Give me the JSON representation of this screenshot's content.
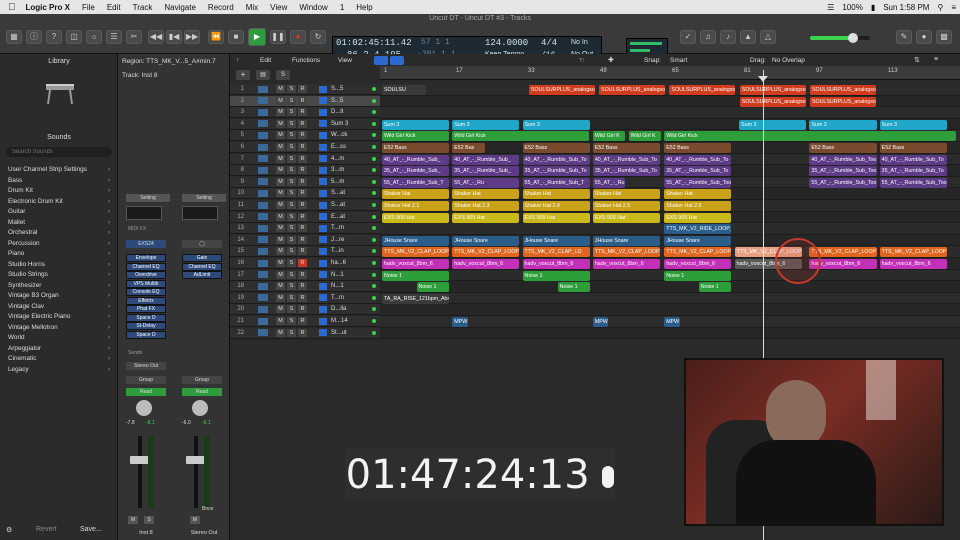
{
  "menubar": {
    "apple": "",
    "app": "Logic Pro X",
    "items": [
      "File",
      "Edit",
      "Track",
      "Navigate",
      "Record",
      "Mix",
      "View",
      "Window",
      "1",
      "Help"
    ],
    "right": [
      "100%",
      "Sun 1:58 PM"
    ]
  },
  "window_title": "Uncut DT - Uncut DT #3 - Tracks",
  "lcd": {
    "smpte": "01:02:45:11.42",
    "bars": "86  2  4  195",
    "ghost1": "57  1  1",
    "ghost2": "-201  1  1",
    "tempo": "124.0000",
    "tempo_mode": "Keep Tempo",
    "sig": "4/4",
    "div": "/16",
    "in": "No In",
    "out": "No Out"
  },
  "library": {
    "title": "Library",
    "sounds": "Sounds",
    "search_placeholder": "Search Sounds",
    "items": [
      "User Channel Strip Settings",
      "Bass",
      "Drum Kit",
      "Electronic Drum Kit",
      "Guitar",
      "Mallet",
      "Orchestral",
      "Percussion",
      "Piano",
      "Studio Horns",
      "Studio Strings",
      "Synthesizer",
      "Vintage B3 Organ",
      "Vintage Clav",
      "Vintage Electric Piano",
      "Vintage Mellotron",
      "World",
      "Arpeggiator",
      "Cinematic",
      "Legacy"
    ],
    "revert": "Revert",
    "save": "Save..."
  },
  "inspector": {
    "region": "Region: TTS_MK_V...5_A#min.7",
    "track": "Track: Inst 8",
    "setting": "Setting",
    "midifx": "MIDI FX",
    "exs": "EXS24",
    "plugins_left": [
      "Envelope",
      "Channel EQ",
      "Overdrive",
      "VPS Multib",
      "Console EQ",
      "Effetrix",
      "Phat FX",
      "Space D",
      "St-Delay",
      "Space D"
    ],
    "plugins_right": [
      "Gain",
      "Channel EQ",
      "AdLimit"
    ],
    "sends": "Sends",
    "stereo_out": "Stereo Out",
    "group": "Group",
    "read": "Read",
    "vol_left": "-7.8",
    "pk_left": "-8.1",
    "vol_right": "-6.0",
    "pk_right": "-6.1",
    "bnce": "Bnce",
    "name_left": "Inst 8",
    "name_right": "Stereo Out"
  },
  "track_header": {
    "edit": "Edit",
    "functions": "Functions",
    "view": "View"
  },
  "snap": {
    "label": "Snap:",
    "value": "Smart",
    "drag_label": "Drag:",
    "drag_value": "No Overlap"
  },
  "ruler": [
    "1",
    "17",
    "33",
    "49",
    "65",
    "81",
    "97",
    "113"
  ],
  "tracks": [
    {
      "n": "1",
      "name": "S...5"
    },
    {
      "n": "2",
      "name": "S...5"
    },
    {
      "n": "3",
      "name": "D...lt"
    },
    {
      "n": "4",
      "name": "Sum 3"
    },
    {
      "n": "5",
      "name": "W...ck"
    },
    {
      "n": "6",
      "name": "E...ss"
    },
    {
      "n": "7",
      "name": "4...m"
    },
    {
      "n": "8",
      "name": "3...m"
    },
    {
      "n": "9",
      "name": "5...m"
    },
    {
      "n": "10",
      "name": "S...at"
    },
    {
      "n": "11",
      "name": "S...at"
    },
    {
      "n": "12",
      "name": "E...at"
    },
    {
      "n": "13",
      "name": "T...m"
    },
    {
      "n": "14",
      "name": "J...re"
    },
    {
      "n": "15",
      "name": "T...in"
    },
    {
      "n": "16",
      "name": "ha...6"
    },
    {
      "n": "17",
      "name": "N...1"
    },
    {
      "n": "18",
      "name": "N...1"
    },
    {
      "n": "19",
      "name": "T...m"
    },
    {
      "n": "20",
      "name": "D...lla"
    },
    {
      "n": "21",
      "name": "M...14"
    },
    {
      "n": "22",
      "name": "St...ut"
    }
  ],
  "regions": [
    {
      "row": 1,
      "label": "SOULSU",
      "start": 0.0,
      "len": 0.08,
      "color": "#3a3a3a"
    },
    {
      "row": 1,
      "label": "SOULSURPLUS_analogso",
      "start": 0.255,
      "len": 0.118,
      "color": "#d23c1e"
    },
    {
      "row": 1,
      "label": "SOULSURPLUS_analogso",
      "start": 0.377,
      "len": 0.118,
      "color": "#d23c1e"
    },
    {
      "row": 1,
      "label": "SOULSURPLUS_analogso",
      "start": 0.499,
      "len": 0.118,
      "color": "#d23c1e"
    },
    {
      "row": 1,
      "label": "SOULSURPLUS_analogso",
      "start": 0.621,
      "len": 0.118,
      "color": "#d23c1e"
    },
    {
      "row": 1,
      "label": "SOULSURPLUS_analogso",
      "start": 0.743,
      "len": 0.118,
      "color": "#d23c1e"
    },
    {
      "row": 2,
      "label": "SOULSURPLUS_analogso",
      "start": 0.621,
      "len": 0.118,
      "color": "#d23c1e"
    },
    {
      "row": 2,
      "label": "SOULSURPLUS_analogso",
      "start": 0.743,
      "len": 0.118,
      "color": "#d23c1e"
    },
    {
      "row": 4,
      "label": "Sum 3",
      "start": 0.0,
      "len": 0.12,
      "color": "#1fa6c9"
    },
    {
      "row": 4,
      "label": "Sum 3",
      "start": 0.122,
      "len": 0.12,
      "color": "#1fa6c9"
    },
    {
      "row": 4,
      "label": "Sum 3",
      "start": 0.244,
      "len": 0.12,
      "color": "#1fa6c9"
    },
    {
      "row": 4,
      "label": "Sum 3",
      "start": 0.62,
      "len": 0.12,
      "color": "#1fa6c9"
    },
    {
      "row": 4,
      "label": "Sum 3",
      "start": 0.742,
      "len": 0.12,
      "color": "#1fa6c9"
    },
    {
      "row": 4,
      "label": "Sum 3",
      "start": 0.864,
      "len": 0.12,
      "color": "#1fa6c9"
    },
    {
      "row": 5,
      "label": "Wild Girl Kick",
      "start": 0.0,
      "len": 0.12,
      "color": "#2e9e3a"
    },
    {
      "row": 5,
      "label": "Wild Girl Kick",
      "start": 0.122,
      "len": 0.24,
      "color": "#2e9e3a"
    },
    {
      "row": 5,
      "label": "Wild Girl K",
      "start": 0.366,
      "len": 0.06,
      "color": "#2e9e3a"
    },
    {
      "row": 5,
      "label": "Wild Girl K",
      "start": 0.428,
      "len": 0.06,
      "color": "#2e9e3a"
    },
    {
      "row": 5,
      "label": "Wild Girl Kick",
      "start": 0.49,
      "len": 0.51,
      "color": "#2e9e3a"
    },
    {
      "row": 6,
      "label": "E52 Bass",
      "start": 0.0,
      "len": 0.12,
      "color": "#7a4a2e"
    },
    {
      "row": 6,
      "label": "E52 Bas",
      "start": 0.122,
      "len": 0.06,
      "color": "#7a4a2e"
    },
    {
      "row": 6,
      "label": "E52 Bass",
      "start": 0.244,
      "len": 0.12,
      "color": "#7a4a2e"
    },
    {
      "row": 6,
      "label": "E52 Bass",
      "start": 0.366,
      "len": 0.12,
      "color": "#7a4a2e"
    },
    {
      "row": 6,
      "label": "E52 Bass",
      "start": 0.49,
      "len": 0.12,
      "color": "#7a4a2e"
    },
    {
      "row": 6,
      "label": "E52 Bass",
      "start": 0.742,
      "len": 0.12,
      "color": "#7a4a2e"
    },
    {
      "row": 6,
      "label": "E52 Bass",
      "start": 0.864,
      "len": 0.12,
      "color": "#7a4a2e"
    },
    {
      "row": 7,
      "label": "40_AT_-_Rumble_Sub_",
      "start": 0.0,
      "len": 0.12,
      "color": "#5d3b86"
    },
    {
      "row": 7,
      "label": "40_AT_-_Rumble_Sub_",
      "start": 0.122,
      "len": 0.12,
      "color": "#5d3b86"
    },
    {
      "row": 7,
      "label": "40_AT_-_Rumble_Sub_To",
      "start": 0.244,
      "len": 0.12,
      "color": "#5d3b86"
    },
    {
      "row": 7,
      "label": "40_AT_-_Rumble_Sub_To",
      "start": 0.366,
      "len": 0.12,
      "color": "#5d3b86"
    },
    {
      "row": 7,
      "label": "40_AT_-_Rumble_Sub_To",
      "start": 0.49,
      "len": 0.12,
      "color": "#5d3b86"
    },
    {
      "row": 7,
      "label": "40_AT_-_Rumble_Sub_Too",
      "start": 0.742,
      "len": 0.12,
      "color": "#5d3b86"
    },
    {
      "row": 7,
      "label": "40_AT_-_Rumble_Sub_To",
      "start": 0.864,
      "len": 0.12,
      "color": "#5d3b86"
    },
    {
      "row": 8,
      "label": "35_AT_-_Rumble_Sub_",
      "start": 0.0,
      "len": 0.12,
      "color": "#5d3b86"
    },
    {
      "row": 8,
      "label": "35_AT_-_Rumble_Sub_",
      "start": 0.122,
      "len": 0.12,
      "color": "#5d3b86"
    },
    {
      "row": 8,
      "label": "35_AT_-_Rumble_Sub_To",
      "start": 0.244,
      "len": 0.12,
      "color": "#5d3b86"
    },
    {
      "row": 8,
      "label": "35_AT_-_Rumble_Sub_To",
      "start": 0.366,
      "len": 0.12,
      "color": "#5d3b86"
    },
    {
      "row": 8,
      "label": "35_AT_-_Rumble_Sub_To",
      "start": 0.49,
      "len": 0.12,
      "color": "#5d3b86"
    },
    {
      "row": 8,
      "label": "35_AT_-_Rumble_Sub_Too",
      "start": 0.742,
      "len": 0.12,
      "color": "#5d3b86"
    },
    {
      "row": 8,
      "label": "35_AT_-_Rumble_Sub_To",
      "start": 0.864,
      "len": 0.12,
      "color": "#5d3b86"
    },
    {
      "row": 9,
      "label": "55_AT_-_Rumble_Sub_T",
      "start": 0.0,
      "len": 0.12,
      "color": "#5d3b86"
    },
    {
      "row": 9,
      "label": "55_AT_-_Ru",
      "start": 0.122,
      "len": 0.12,
      "color": "#5d3b86"
    },
    {
      "row": 9,
      "label": "55_AT_-_Rumble_Sub_T",
      "start": 0.244,
      "len": 0.12,
      "color": "#5d3b86"
    },
    {
      "row": 9,
      "label": "55_AT_-_Ru",
      "start": 0.366,
      "len": 0.06,
      "color": "#5d3b86"
    },
    {
      "row": 9,
      "label": "55_AT_-_Rumble_Sub_Too",
      "start": 0.49,
      "len": 0.12,
      "color": "#5d3b86"
    },
    {
      "row": 9,
      "label": "55_AT_-_Rumble_Sub_Too",
      "start": 0.742,
      "len": 0.12,
      "color": "#5d3b86"
    },
    {
      "row": 9,
      "label": "55_AT_-_Rumble_Sub_Too",
      "start": 0.864,
      "len": 0.12,
      "color": "#5d3b86"
    },
    {
      "row": 10,
      "label": "Shaker Hat",
      "start": 0.0,
      "len": 0.12,
      "color": "#c9a21a"
    },
    {
      "row": 10,
      "label": "Shaker Hat",
      "start": 0.122,
      "len": 0.12,
      "color": "#c9a21a"
    },
    {
      "row": 10,
      "label": "Shaker Hat",
      "start": 0.244,
      "len": 0.12,
      "color": "#c9a21a"
    },
    {
      "row": 10,
      "label": "Shaker Hat",
      "start": 0.366,
      "len": 0.12,
      "color": "#c9a21a"
    },
    {
      "row": 10,
      "label": "Shaker Hat",
      "start": 0.49,
      "len": 0.12,
      "color": "#c9a21a"
    },
    {
      "row": 11,
      "label": "Shaker Hat 2.1",
      "start": 0.0,
      "len": 0.12,
      "color": "#c9a21a"
    },
    {
      "row": 11,
      "label": "Shaker Hat 2.3",
      "start": 0.122,
      "len": 0.12,
      "color": "#c9a21a"
    },
    {
      "row": 11,
      "label": "Shaker Hat 2.4",
      "start": 0.244,
      "len": 0.12,
      "color": "#c9a21a"
    },
    {
      "row": 11,
      "label": "Shaker Hat 2.5",
      "start": 0.366,
      "len": 0.12,
      "color": "#c9a21a"
    },
    {
      "row": 11,
      "label": "Shaker Hat 2.6",
      "start": 0.49,
      "len": 0.12,
      "color": "#c9a21a"
    },
    {
      "row": 12,
      "label": "EXS 909 Hat",
      "start": 0.0,
      "len": 0.12,
      "color": "#c9b91a"
    },
    {
      "row": 12,
      "label": "EXS 909 Hat",
      "start": 0.122,
      "len": 0.12,
      "color": "#c9b91a"
    },
    {
      "row": 12,
      "label": "EXS 909 Hat",
      "start": 0.244,
      "len": 0.12,
      "color": "#c9b91a"
    },
    {
      "row": 12,
      "label": "EXS 909 Hat",
      "start": 0.366,
      "len": 0.12,
      "color": "#c9b91a"
    },
    {
      "row": 12,
      "label": "EXS 909 Hat",
      "start": 0.49,
      "len": 0.12,
      "color": "#c9b91a"
    },
    {
      "row": 13,
      "label": "TTS_MK_V2_RIDE_LOOP_THE_JUICE_F",
      "start": 0.49,
      "len": 0.12,
      "color": "#2a5d8a"
    },
    {
      "row": 14,
      "label": "JHouse Snare",
      "start": 0.0,
      "len": 0.12,
      "color": "#2a5d8a"
    },
    {
      "row": 14,
      "label": "JHouse Snare",
      "start": 0.122,
      "len": 0.12,
      "color": "#2a5d8a"
    },
    {
      "row": 14,
      "label": "JHouse Snare",
      "start": 0.244,
      "len": 0.12,
      "color": "#2a5d8a"
    },
    {
      "row": 14,
      "label": "JHouse Snare",
      "start": 0.366,
      "len": 0.12,
      "color": "#2a5d8a"
    },
    {
      "row": 14,
      "label": "JHouse Snare",
      "start": 0.49,
      "len": 0.12,
      "color": "#2a5d8a"
    },
    {
      "row": 15,
      "label": "TTS_MK_V2_CLAP_LOOP",
      "start": 0.0,
      "len": 0.12,
      "color": "#e0651e"
    },
    {
      "row": 15,
      "label": "TTS_MK_V2_CLAP_LOOP",
      "start": 0.122,
      "len": 0.12,
      "color": "#e0651e"
    },
    {
      "row": 15,
      "label": "TTS_MK_V2_CLAP_LO",
      "start": 0.244,
      "len": 0.12,
      "color": "#e0651e"
    },
    {
      "row": 15,
      "label": "TTS_MK_V2_CLAP_LOOP",
      "start": 0.366,
      "len": 0.12,
      "color": "#e0651e"
    },
    {
      "row": 15,
      "label": "TTS_MK_V2_CLAP_LOOP",
      "start": 0.49,
      "len": 0.12,
      "color": "#e0651e"
    },
    {
      "row": 15,
      "label": "TTS_MK_V2_CLAP_LOOP",
      "start": 0.612,
      "len": 0.12,
      "color": "#e8a080"
    },
    {
      "row": 15,
      "label": "TTS_MK_V2_CLAP_LOOP",
      "start": 0.742,
      "len": 0.12,
      "color": "#e0651e"
    },
    {
      "row": 15,
      "label": "TTS_MK_V2_CLAP_LOOP",
      "start": 0.864,
      "len": 0.12,
      "color": "#e0651e"
    },
    {
      "row": 16,
      "label": "hadv_voxcut_8bm_6",
      "start": 0.0,
      "len": 0.12,
      "color": "#c230b8"
    },
    {
      "row": 16,
      "label": "hadv_voxcut_8bm_6",
      "start": 0.122,
      "len": 0.12,
      "color": "#c230b8"
    },
    {
      "row": 16,
      "label": "hadv_voxcut_8bm_6",
      "start": 0.244,
      "len": 0.12,
      "color": "#c230b8"
    },
    {
      "row": 16,
      "label": "hadv_voxcut_8bm_6",
      "start": 0.366,
      "len": 0.12,
      "color": "#c230b8"
    },
    {
      "row": 16,
      "label": "hadv_voxcut_8bm_6",
      "start": 0.49,
      "len": 0.12,
      "color": "#c230b8"
    },
    {
      "row": 16,
      "label": "hadv_voxcut_8bm_6",
      "start": 0.612,
      "len": 0.12,
      "color": "#5a5a5a"
    },
    {
      "row": 16,
      "label": "hadv_voxcut_8bm_6",
      "start": 0.742,
      "len": 0.12,
      "color": "#c230b8"
    },
    {
      "row": 16,
      "label": "hadv_voxcut_8bm_6",
      "start": 0.864,
      "len": 0.12,
      "color": "#c230b8"
    },
    {
      "row": 17,
      "label": "Noise 1",
      "start": 0.0,
      "len": 0.12,
      "color": "#2e9e3a"
    },
    {
      "row": 17,
      "label": "Noise 1",
      "start": 0.244,
      "len": 0.12,
      "color": "#2e9e3a"
    },
    {
      "row": 17,
      "label": "Noise 1",
      "start": 0.49,
      "len": 0.12,
      "color": "#2e9e3a"
    },
    {
      "row": 18,
      "label": "Noise 1",
      "start": 0.06,
      "len": 0.06,
      "color": "#2e9e3a"
    },
    {
      "row": 18,
      "label": "Noise 1",
      "start": 0.305,
      "len": 0.06,
      "color": "#2e9e3a"
    },
    {
      "row": 18,
      "label": "Noise 1",
      "start": 0.55,
      "len": 0.06,
      "color": "#2e9e3a"
    },
    {
      "row": 19,
      "label": "TA_RA_RISE_121bpm_Abm",
      "start": 0.0,
      "len": 0.12,
      "color": "#3a3a3a"
    },
    {
      "row": 21,
      "label": "MPW",
      "start": 0.122,
      "len": 0.03,
      "color": "#2a5d8a"
    },
    {
      "row": 21,
      "label": "MPW",
      "start": 0.366,
      "len": 0.03,
      "color": "#2a5d8a"
    },
    {
      "row": 21,
      "label": "MPW",
      "start": 0.49,
      "len": 0.03,
      "color": "#2a5d8a"
    }
  ],
  "clock": "01:47:24:13",
  "colors": {
    "accent": "#2c9c3c",
    "record": "#e0312b",
    "read": "#2c9c3c"
  }
}
